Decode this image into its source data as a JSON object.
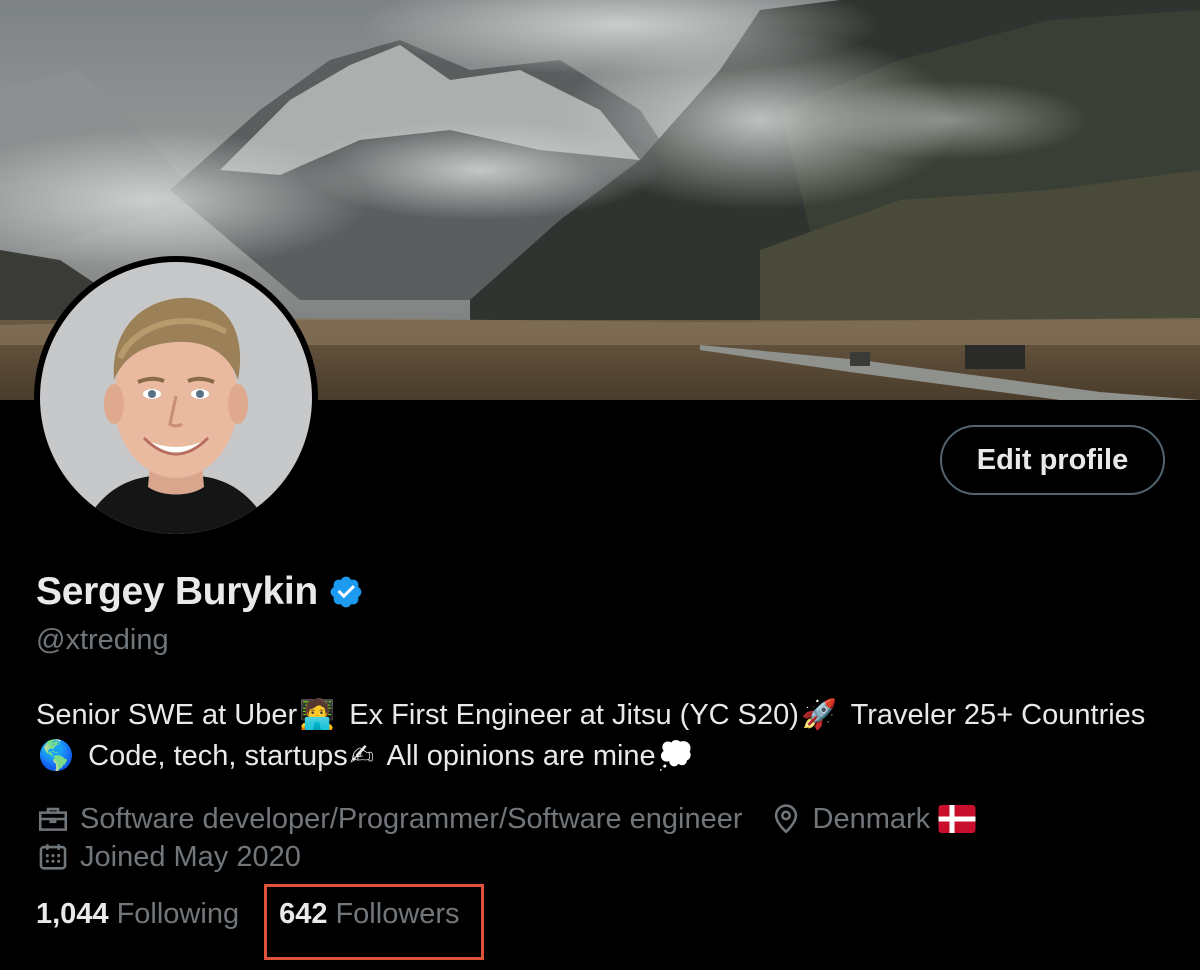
{
  "profile": {
    "display_name": "Sergey Burykin",
    "handle": "@xtreding",
    "verified": true,
    "edit_button_label": "Edit profile",
    "bio": {
      "part1": "Senior SWE at Uber",
      "part2": "Ex First Engineer at Jitsu (YC S20)",
      "part3": "Traveler 25+ Countries",
      "part4": "Code, tech, startups",
      "part5": "All opinions are mine"
    },
    "bio_emojis": {
      "e1": "🧑‍💻",
      "e2": "🚀",
      "e3": "🌎",
      "e4": "✍",
      "e5": "💭"
    },
    "profession": "Software developer/Programmer/Software engineer",
    "location": "Denmark",
    "joined": "Joined May 2020",
    "following_count": "1,044",
    "following_label": "Following",
    "followers_count": "642",
    "followers_label": "Followers"
  },
  "icons": {
    "verified": "verified-badge-icon",
    "profession": "briefcase-icon",
    "location": "location-pin-icon",
    "joined": "calendar-icon",
    "flag": "denmark-flag-icon"
  },
  "colors": {
    "background": "#000000",
    "text_primary": "#e7e9ea",
    "text_secondary": "#71767b",
    "verified_blue": "#1d9bf0",
    "highlight_border": "#e0533a",
    "button_border": "#536471"
  }
}
